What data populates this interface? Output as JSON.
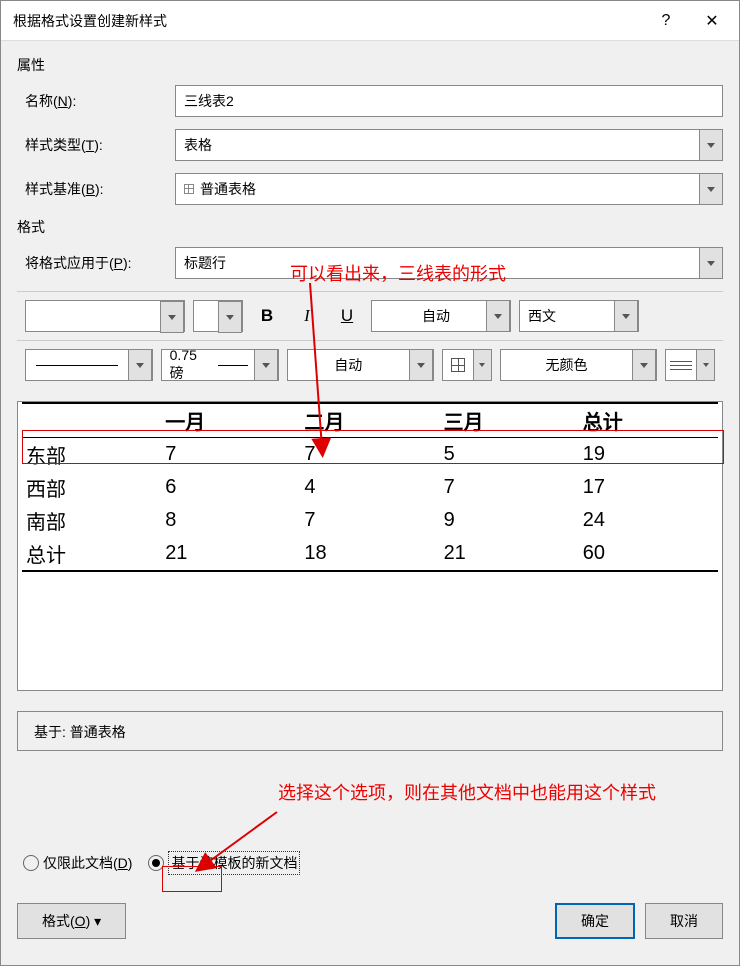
{
  "titlebar": {
    "title": "根据格式设置创建新样式"
  },
  "section_attr": "属性",
  "labels": {
    "name": "名称(",
    "name_u": "N",
    "name_end": "):",
    "styletype": "样式类型(",
    "styletype_u": "T",
    "styletype_end": "):",
    "basedon": "样式基准(",
    "basedon_u": "B",
    "basedon_end": "):",
    "format_section": "格式",
    "applyto": "将格式应用于(",
    "applyto_u": "P",
    "applyto_end": "):"
  },
  "values": {
    "name": "三线表2",
    "styletype": "表格",
    "basedon": "普通表格",
    "applyto": "标题行",
    "fontcolor": "自动",
    "script": "西文",
    "weight": "0.75 磅",
    "bordercolor": "自动",
    "fill": "无颜色"
  },
  "table": {
    "headers": [
      "",
      "一月",
      "二月",
      "三月",
      "总计"
    ],
    "rows": [
      [
        "东部",
        "7",
        "7",
        "5",
        "19"
      ],
      [
        "西部",
        "6",
        "4",
        "7",
        "17"
      ],
      [
        "南部",
        "8",
        "7",
        "9",
        "24"
      ],
      [
        "总计",
        "21",
        "18",
        "21",
        "60"
      ]
    ]
  },
  "desc": "基于: 普通表格",
  "annotations": {
    "a1": "可以看出来，三线表的形式",
    "a2": "选择这个选项，则在其他文档中也能用这个样式"
  },
  "radios": {
    "r1": "仅限此文档(",
    "r1_u": "D",
    "r1_end": ")",
    "r2": "基于该模板的新文档"
  },
  "buttons": {
    "format": "格式(",
    "format_u": "O",
    "format_end": ")",
    "ok": "确定",
    "cancel": "取消"
  }
}
